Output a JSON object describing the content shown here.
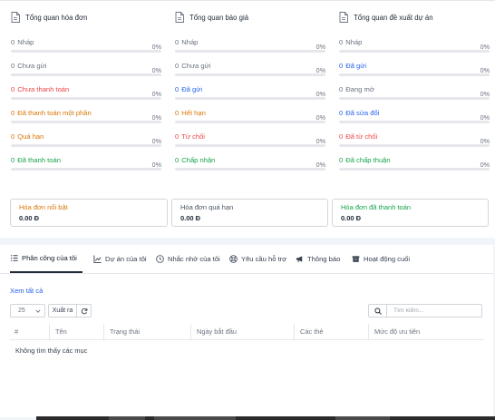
{
  "overview": [
    {
      "title": "Tổng quan hóa đơn",
      "stats": [
        {
          "count": "0",
          "label": "Nháp",
          "percent": "0%",
          "color": "#6b7280"
        },
        {
          "count": "0",
          "label": "Chưa gửi",
          "percent": "0%",
          "color": "#6b7280"
        },
        {
          "count": "0",
          "label": "Chưa thanh toán",
          "percent": "0%",
          "color": "#ef4444"
        },
        {
          "count": "0",
          "label": "Đã thanh toán một phần",
          "percent": "0%",
          "color": "#d97706"
        },
        {
          "count": "0",
          "label": "Quá hạn",
          "percent": "0%",
          "color": "#d97706"
        },
        {
          "count": "0",
          "label": "Đã thanh toán",
          "percent": "0%",
          "color": "#16a34a"
        }
      ]
    },
    {
      "title": "Tổng quan báo giá",
      "stats": [
        {
          "count": "0",
          "label": "Nháp",
          "percent": "0%",
          "color": "#6b7280"
        },
        {
          "count": "0",
          "label": "Chưa gửi",
          "percent": "0%",
          "color": "#6b7280"
        },
        {
          "count": "0",
          "label": "Đã gửi",
          "percent": "0%",
          "color": "#2563eb"
        },
        {
          "count": "0",
          "label": "Hết hạn",
          "percent": "0%",
          "color": "#d97706"
        },
        {
          "count": "0",
          "label": "Từ chối",
          "percent": "0%",
          "color": "#ef4444"
        },
        {
          "count": "0",
          "label": "Chấp nhận",
          "percent": "0%",
          "color": "#16a34a"
        }
      ]
    },
    {
      "title": "Tổng quan đề xuất dự án",
      "stats": [
        {
          "count": "0",
          "label": "Nháp",
          "percent": "0%",
          "color": "#6b7280"
        },
        {
          "count": "0",
          "label": "Đã gửi",
          "percent": "0%",
          "color": "#2563eb"
        },
        {
          "count": "0",
          "label": "Đang mở",
          "percent": "0%",
          "color": "#6b7280"
        },
        {
          "count": "0",
          "label": "Đã sửa đổi",
          "percent": "0%",
          "color": "#2563eb"
        },
        {
          "count": "0",
          "label": "Đã từ chối",
          "percent": "0%",
          "color": "#ef4444"
        },
        {
          "count": "0",
          "label": "Đã chấp thuận",
          "percent": "0%",
          "color": "#16a34a"
        }
      ]
    }
  ],
  "summary_cards": [
    {
      "title": "Hóa đơn nổi bật",
      "amount": "0.00 Đ",
      "color": "#d97706"
    },
    {
      "title": "Hóa đơn quá hạn",
      "amount": "0.00 Đ",
      "color": "#4b5563"
    },
    {
      "title": "Hóa đơn đã thanh toán",
      "amount": "0.00 Đ",
      "color": "#16a34a"
    }
  ],
  "tabs": [
    {
      "label": "Phân công của tôi",
      "icon": "list-icon",
      "active": true
    },
    {
      "label": "Dự án của tôi",
      "icon": "chart-icon",
      "active": false
    },
    {
      "label": "Nhắc nhở của tôi",
      "icon": "clock-icon",
      "active": false
    },
    {
      "label": "Yêu cầu hỗ trợ",
      "icon": "lifebuoy-icon",
      "active": false
    },
    {
      "label": "Thông báo",
      "icon": "megaphone-icon",
      "active": false
    },
    {
      "label": "Hoạt động cuối",
      "icon": "archive-icon",
      "active": false
    }
  ],
  "toolbar": {
    "view_all": "Xem tất cả",
    "page_size": "25",
    "export_label": "Xuất ra",
    "search_placeholder": "Tìm kiếm..."
  },
  "table": {
    "columns": [
      "#",
      "Tên",
      "Trạng thái",
      "Ngày bắt đầu",
      "Các thẻ",
      "Mức độ ưu tiên"
    ],
    "empty_message": "Không tìm thấy các mục"
  }
}
